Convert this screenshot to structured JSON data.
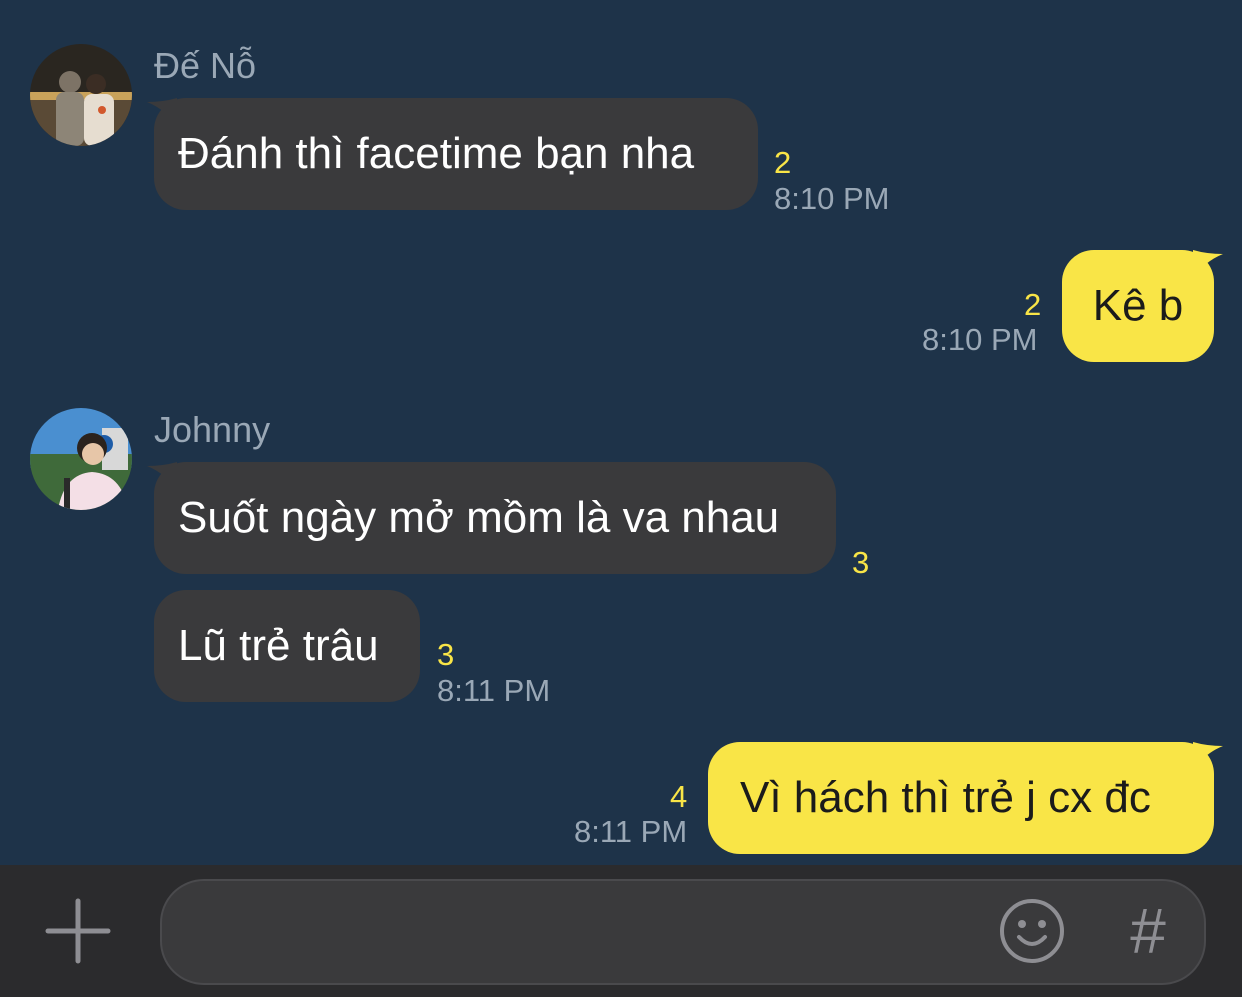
{
  "colors": {
    "background": "#1e3349",
    "incoming_bubble": "#3a3a3c",
    "outgoing_bubble": "#f9e547",
    "unread_count": "#f9e547",
    "meta_text": "#9aa8b6",
    "composer_bar": "#2b2b2d"
  },
  "messages": [
    {
      "sender": "Đế Nỗ",
      "text": "Đánh thì facetime bạn nha",
      "unread": "2",
      "time": "8:10 PM",
      "direction": "incoming"
    },
    {
      "text": "Kê b",
      "unread": "2",
      "time": "8:10 PM",
      "direction": "outgoing"
    },
    {
      "sender": "Johnny",
      "text": "Suốt ngày mở mồm là va nhau",
      "unread": "3",
      "direction": "incoming"
    },
    {
      "text": "Lũ trẻ trâu",
      "unread": "3",
      "time": "8:11 PM",
      "direction": "incoming"
    },
    {
      "text": "Vì hách thì trẻ j cx đc",
      "unread": "4",
      "time": "8:11 PM",
      "direction": "outgoing"
    }
  ],
  "composer": {
    "input_value": "",
    "placeholder": "",
    "plus_icon": "plus-icon",
    "emoji_icon": "emoji-smile-icon",
    "hashtag_glyph": "#"
  }
}
